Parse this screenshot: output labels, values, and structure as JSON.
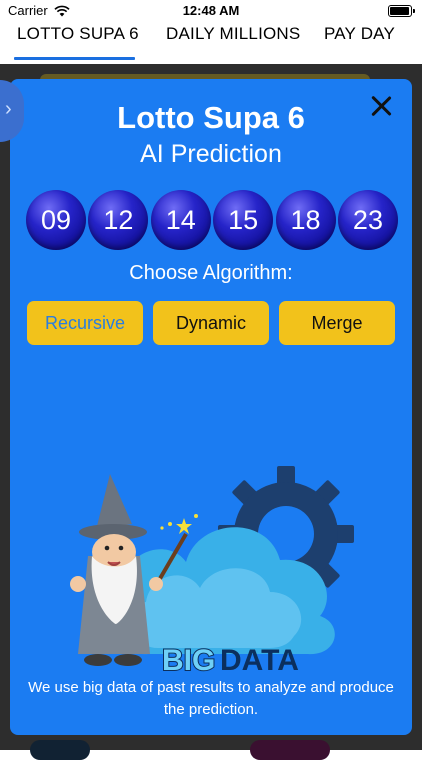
{
  "status_bar": {
    "carrier": "Carrier",
    "time": "12:48 AM",
    "wifi_icon": "wifi-icon",
    "battery_icon": "battery-icon"
  },
  "tabs": [
    {
      "label": "LOTTO SUPA 6",
      "selected": true
    },
    {
      "label": "DAILY MILLIONS",
      "selected": false
    },
    {
      "label": "PAY DAY",
      "selected": false
    }
  ],
  "modal": {
    "title": "Lotto Supa 6",
    "subtitle": "AI Prediction",
    "numbers": [
      "09",
      "12",
      "14",
      "15",
      "18",
      "23"
    ],
    "choose_label": "Choose Algorithm:",
    "algorithms": [
      {
        "label": "Recursive",
        "selected": true
      },
      {
        "label": "Dynamic",
        "selected": false
      },
      {
        "label": "Merge",
        "selected": false
      }
    ],
    "illustration_text": {
      "big": "BIG",
      "data": "DATA"
    },
    "footer_text": "We use big data of past results to analyze and produce the prediction."
  },
  "colors": {
    "modal_bg": "#1b7cf2",
    "button_bg": "#f2c21b",
    "selected_algo_text": "#2a7de0",
    "tab_indicator": "#1a6fe0",
    "ball": "#1e1cb8"
  }
}
